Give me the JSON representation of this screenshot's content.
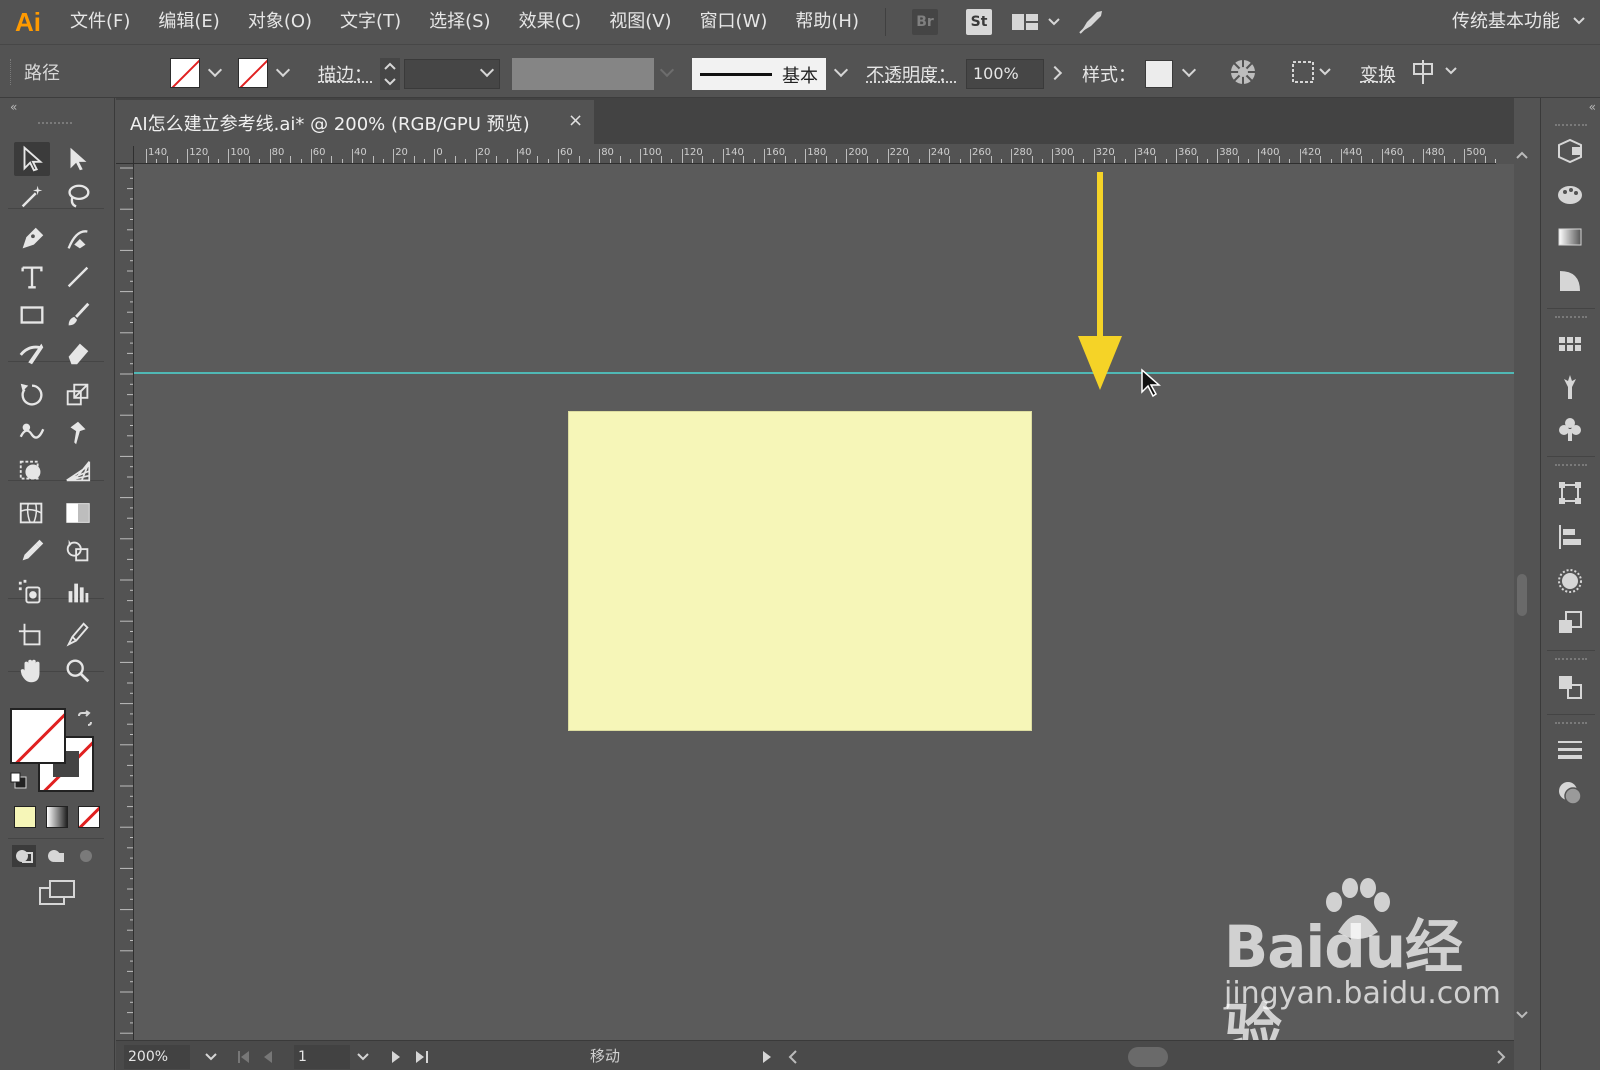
{
  "app": {
    "logo": "Ai"
  },
  "menu": {
    "items": [
      "文件(F)",
      "编辑(E)",
      "对象(O)",
      "文字(T)",
      "选择(S)",
      "效果(C)",
      "视图(V)",
      "窗口(W)",
      "帮助(H)"
    ],
    "badge_br": "Br",
    "badge_st": "St",
    "workspace": "传统基本功能"
  },
  "control": {
    "selection_type": "路径",
    "stroke_label": "描边：",
    "brush_label": "基本",
    "opacity_label": "不透明度：",
    "opacity_value": "100%",
    "style_label": "样式：",
    "transform_label": "变换"
  },
  "document": {
    "tab_title": "AI怎么建立参考线.ai* @ 200% (RGB/GPU 预览)",
    "close_glyph": "×"
  },
  "ruler": {
    "h_labels": [
      "140",
      "120",
      "100",
      "80",
      "60",
      "40",
      "20",
      "0",
      "20",
      "40",
      "60",
      "80",
      "100",
      "120",
      "140",
      "160",
      "180",
      "200",
      "220",
      "240",
      "260",
      "280",
      "300",
      "320",
      "340",
      "360",
      "380",
      "400",
      "420",
      "440",
      "460",
      "480",
      "500"
    ]
  },
  "status": {
    "zoom": "200%",
    "artboard": "1",
    "tool_status": "移动"
  },
  "watermark": {
    "brand": "Baidu经验",
    "url": "jingyan.baidu.com"
  },
  "colors": {
    "accent_logo": "#ff9a00",
    "guide": "#4fc9c6",
    "rectangle_fill": "#f6f6b8",
    "annotation_arrow": "#f5d327",
    "canvas_bg": "#5b5b5b"
  },
  "icons": {
    "tools": [
      "selection-tool-icon",
      "direct-selection-tool-icon",
      "magic-wand-tool-icon",
      "lasso-tool-icon",
      "pen-tool-icon",
      "curvature-tool-icon",
      "type-tool-icon",
      "line-segment-tool-icon",
      "rectangle-tool-icon",
      "paintbrush-tool-icon",
      "shaper-tool-icon",
      "eraser-tool-icon",
      "rotate-tool-icon",
      "scale-tool-icon",
      "warp-tool-icon",
      "puppet-warp-tool-icon",
      "free-transform-tool-icon",
      "perspective-grid-tool-icon",
      "mesh-tool-icon",
      "gradient-tool-icon",
      "eyedropper-tool-icon",
      "shape-builder-tool-icon",
      "symbol-sprayer-tool-icon",
      "column-graph-tool-icon",
      "artboard-tool-icon",
      "slice-tool-icon",
      "hand-tool-icon",
      "zoom-tool-icon"
    ]
  }
}
